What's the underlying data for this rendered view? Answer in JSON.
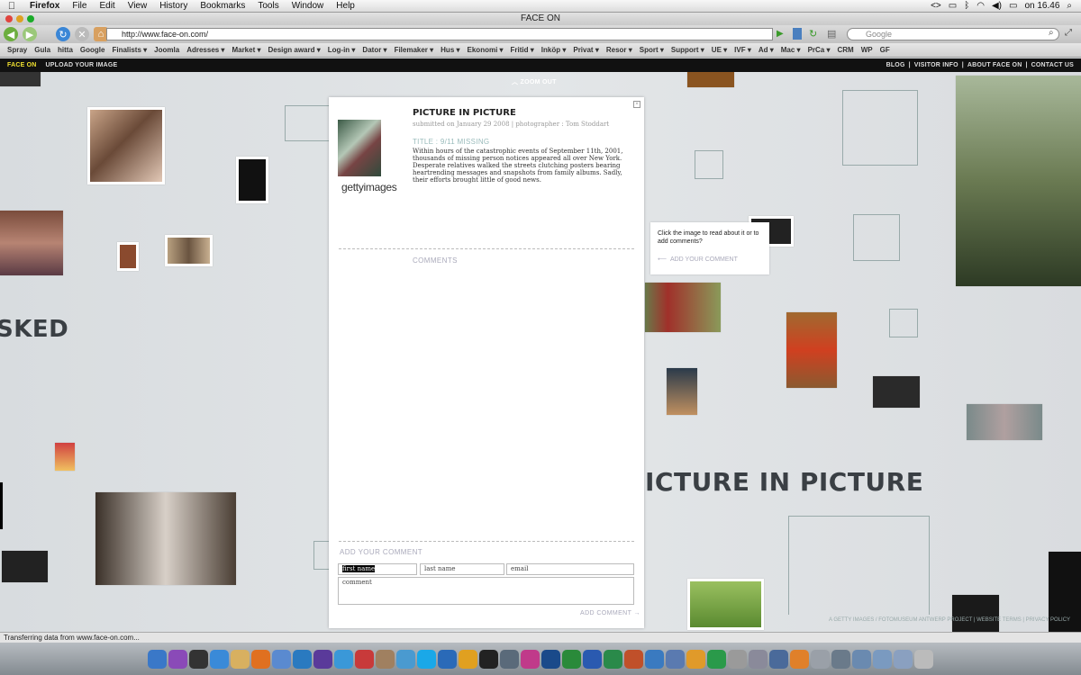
{
  "menubar": {
    "items": [
      "Firefox",
      "File",
      "Edit",
      "View",
      "History",
      "Bookmarks",
      "Tools",
      "Window",
      "Help"
    ],
    "clock": "on 16.46"
  },
  "window": {
    "title": "FACE ON"
  },
  "browser": {
    "url": "http://www.face-on.com/",
    "search_placeholder": "Google"
  },
  "bookmarks": [
    "Spray",
    "Gula",
    "hitta",
    "Google",
    "Finalists ▾",
    "Joomla",
    "Adresses ▾",
    "Market ▾",
    "Design award ▾",
    "Log-in ▾",
    "Dator ▾",
    "Filemaker ▾",
    "Hus ▾",
    "Ekonomi ▾",
    "Fritid ▾",
    "Inköp ▾",
    "Privat ▾",
    "Resor ▾",
    "Sport ▾",
    "Support ▾",
    "UE ▾",
    "IVF ▾",
    "Ad ▾",
    "Mac ▾",
    "PrCa ▾",
    "CRM",
    "WP",
    "GF"
  ],
  "site": {
    "brand": "FACE ON",
    "upload": "UPLOAD YOUR IMAGE",
    "right_links": [
      "BLOG",
      "|",
      "VISITOR INFO",
      "|",
      "ABOUT FACE ON",
      "|",
      "CONTACT US"
    ],
    "zoom_out": "ZOOM OUT",
    "big_left": "SKED",
    "big_right": "ICTURE IN PICTURE",
    "credits": "A GETTY IMAGES / FOTOMUSEUM ANTWERP PROJECT | WEBSITE TERMS | PRIVACY POLICY"
  },
  "panel": {
    "title": "PICTURE IN PICTURE",
    "meta": "submitted on January 29 2008  |  photographer : Tom Stoddart",
    "subtitle": "TITLE : 9/11 MISSING",
    "description": "Within hours of the catastrophic events of September 11th, 2001, thousands of missing person notices appeared all over New York. Desperate relatives walked the streets clutching posters bearing heartrending messages and snapshots from family albums. Sadly, their efforts brought little of good news.",
    "getty": "gettyimages",
    "comments_label": "COMMENTS",
    "add_comment_label": "ADD YOUR COMMENT",
    "first_name": "first name",
    "last_name": "last name",
    "email": "email",
    "comment": "comment",
    "add_comment_button": "ADD COMMENT →"
  },
  "tip": {
    "text": "Click the image to read about it or to add comments?",
    "add": "ADD YOUR COMMENT"
  },
  "status": "Transferring data from www.face-on.com...",
  "dock_icons": [
    "finder-icon",
    "ichat-icon",
    "dashboard-icon",
    "safari-icon",
    "notes-icon",
    "firefox-icon",
    "mail-icon",
    "photos-icon",
    "imovie-icon",
    "itunes-icon",
    "ical-icon",
    "address-icon",
    "preview-icon",
    "skype-icon",
    "qt-icon",
    "chrome-icon",
    "terminal-icon",
    "vmware-icon",
    "flower-icon",
    "photoshop-icon",
    "dreamweaver-icon",
    "word-icon",
    "excel-icon",
    "powerpoint-icon",
    "entourage-icon",
    "keynote-icon",
    "pages-icon",
    "numbers-icon",
    "script-icon",
    "db-icon",
    "filemaker-icon",
    "vlc-icon",
    "help-icon",
    "migrate-icon",
    "folder-icon",
    "folder2-icon",
    "folder3-icon",
    "trash-icon"
  ]
}
